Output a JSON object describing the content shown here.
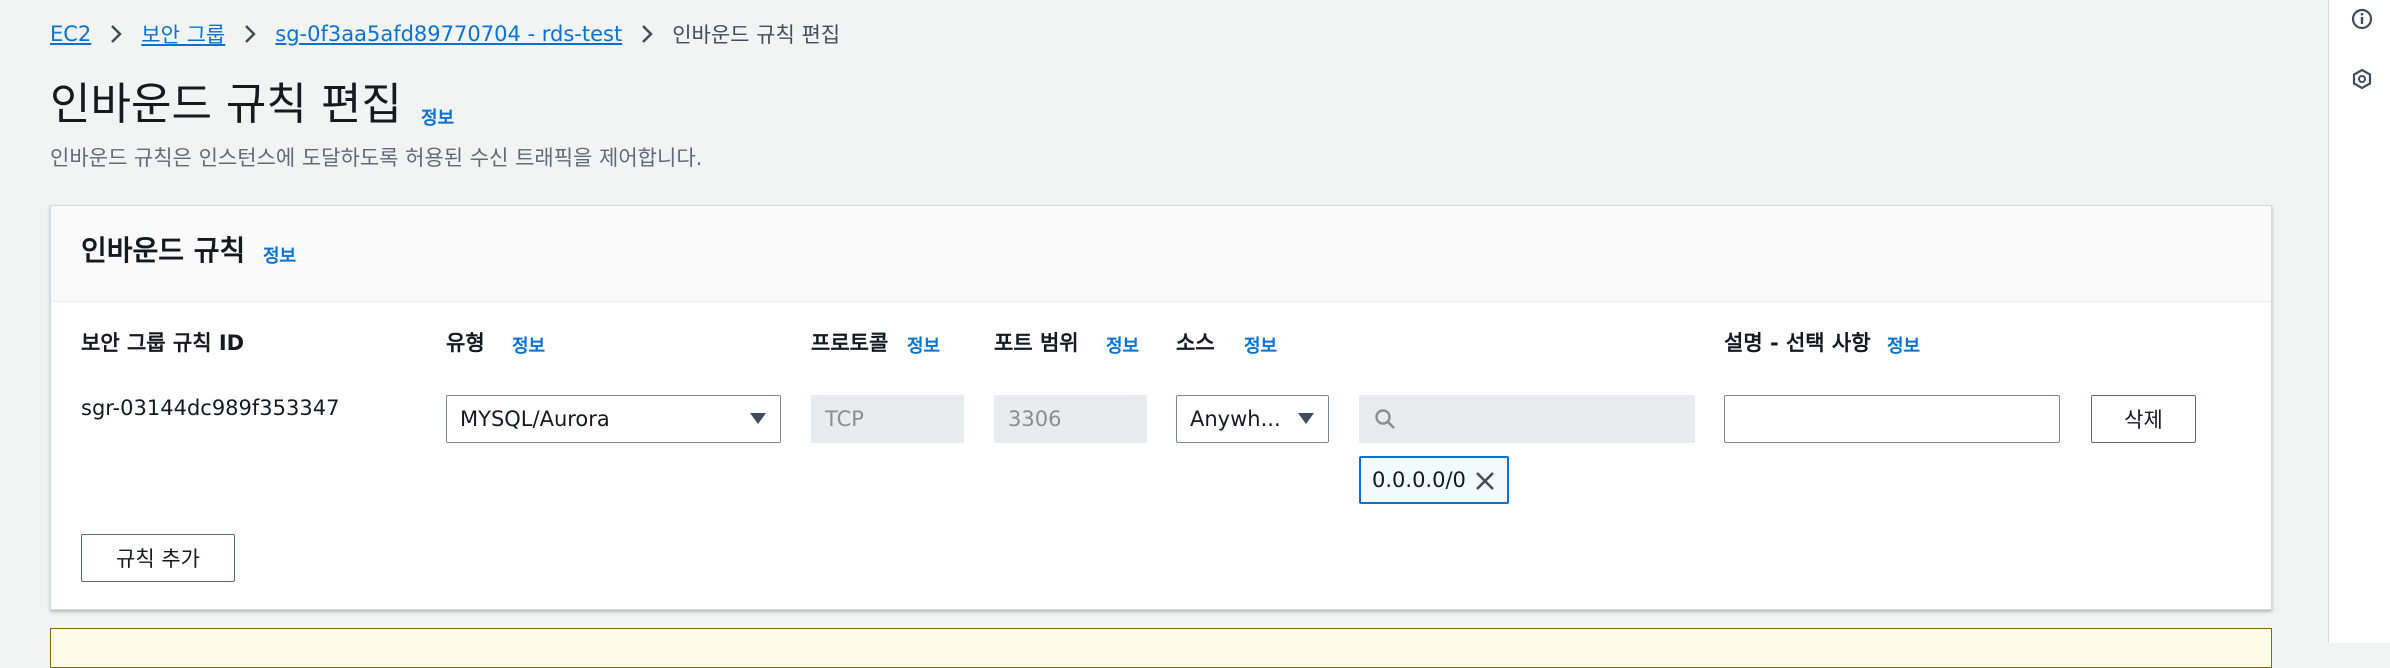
{
  "breadcrumb": {
    "items": [
      "EC2",
      "보안 그룹",
      "sg-0f3aa5afd89770704 - rds-test"
    ],
    "current": "인바운드 규칙 편집"
  },
  "page": {
    "title": "인바운드 규칙 편집",
    "info": "정보",
    "description": "인바운드 규칙은 인스턴스에 도달하도록 허용된 수신 트래픽을 제어합니다."
  },
  "panel": {
    "title": "인바운드 규칙",
    "info": "정보",
    "columns": {
      "rule_id": "보안 그룹 규칙 ID",
      "type": "유형",
      "protocol": "프로토콜",
      "port_range": "포트 범위",
      "source": "소스",
      "description": "설명 - 선택 사항"
    },
    "column_info": "정보",
    "rule": {
      "id": "sgr-03144dc989f353347",
      "type": "MYSQL/Aurora",
      "protocol": "TCP",
      "port_range": "3306",
      "source": "Anywh...",
      "search_value": "",
      "cidr_token": "0.0.0.0/0",
      "description_value": "",
      "delete_label": "삭제"
    },
    "add_rule_label": "규칙 추가"
  },
  "rail": {
    "icons": [
      "info-icon",
      "feedback-icon"
    ]
  },
  "colors": {
    "link": "#0972d3",
    "background": "#f2f3f3",
    "token_border": "#0972d3"
  }
}
